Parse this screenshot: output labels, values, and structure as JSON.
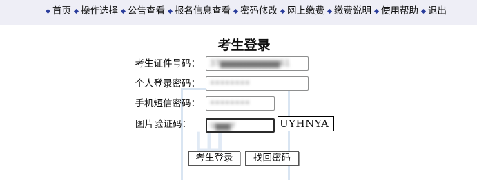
{
  "nav": {
    "items": [
      "首页",
      "操作选择",
      "公告查看",
      "报名信息查看",
      "密码修改",
      "网上缴费",
      "缴费说明",
      "使用帮助",
      "退出"
    ]
  },
  "login": {
    "title": "考生登录",
    "id_label": "考生证件号码：",
    "id_value": "37▆▆▆▆▆▆▆▆▆▆▆▆61",
    "password_label": "个人登录密码：",
    "password_value": "••••••••",
    "sms_label": "手机短信密码：",
    "sms_value": "••••••••",
    "captcha_label": "图片验证码：",
    "captcha_value": "U▆▆▆Y",
    "captcha_image_text": "UYHNYA",
    "login_button": "考生登录",
    "recover_button": "找回密码"
  },
  "colors": {
    "topbar_bg": "#eeeef6",
    "nav_bullet": "#2a3d9c"
  }
}
